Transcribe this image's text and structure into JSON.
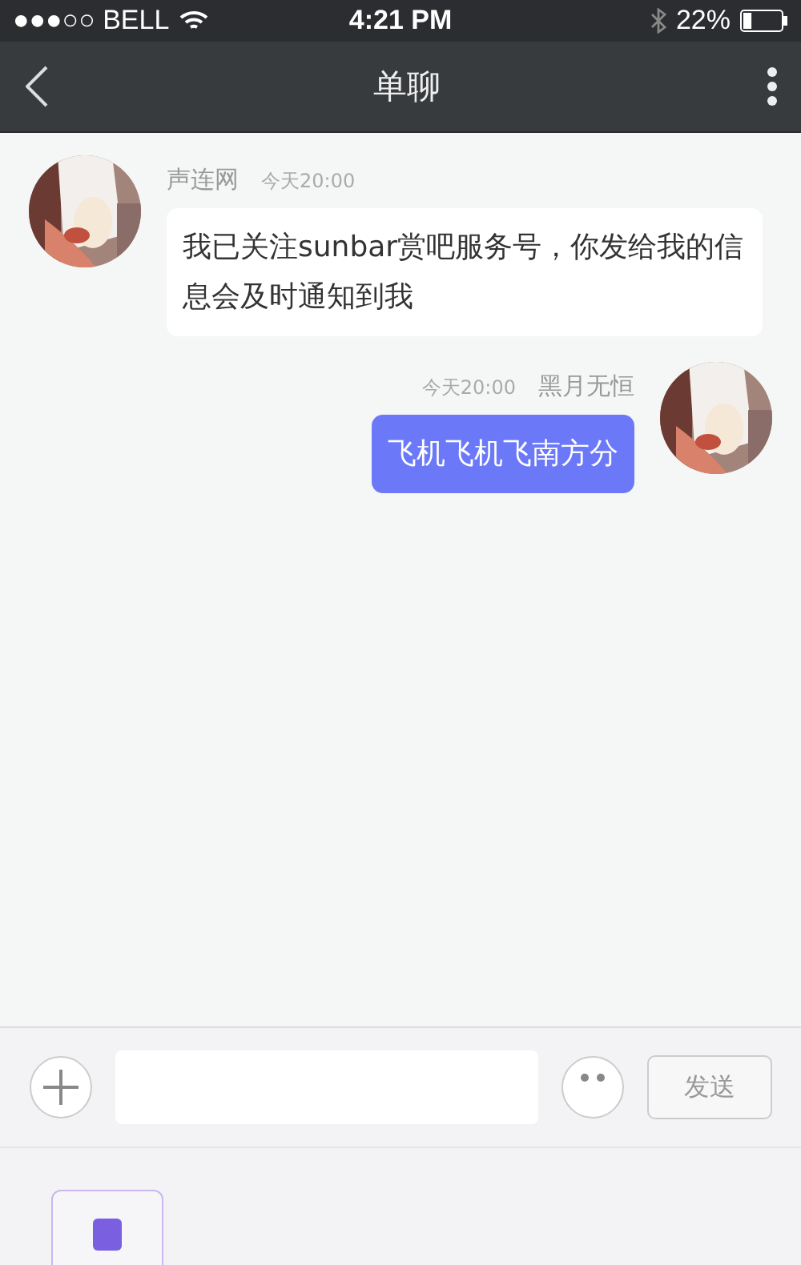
{
  "status_bar": {
    "carrier": "●●●○○ BELL",
    "time": "4:21 PM",
    "battery": "22%"
  },
  "nav_bar": {
    "title": "单聊"
  },
  "messages": [
    {
      "kind": "incoming",
      "sender": "声连网",
      "time": "今天20:00",
      "text": "我已关注sunbar赏吧服务号，你发给我的信息会及时通知到我"
    },
    {
      "kind": "outgoing",
      "sender": "黑月无恒",
      "time": "今天20:00",
      "text": "飞机飞机飞南方分"
    }
  ],
  "input_bar": {
    "send_label": "发送"
  }
}
